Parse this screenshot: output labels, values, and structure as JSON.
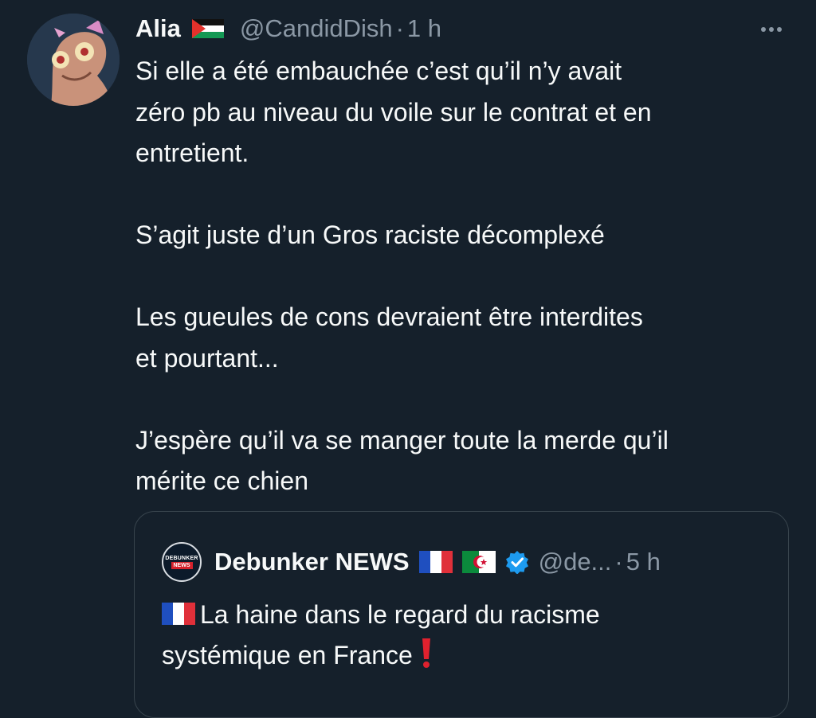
{
  "tweet": {
    "author_name": "Alia",
    "author_handle": "@CandidDish",
    "separator": "·",
    "time": "1 h",
    "author_flag_icon": "palestine-flag-icon",
    "text": "Si elle a été embauchée c’est qu’il n’y avait\nzéro pb au niveau du voile sur le contrat et en\nentretient.\n\nS’agit juste d’un Gros raciste décomplexé\n\nLes gueules de cons devraient être interdites\net pourtant...\n\nJ’espère qu’il va se manger toute la merde qu’il\nmérite ce chien",
    "more_icon": "more-options-icon"
  },
  "quote": {
    "avatar_text_top": "DEBUNKER",
    "avatar_text_bottom": "NEWS",
    "author_name": "Debunker NEWS",
    "author_handle": "@de...",
    "separator": "·",
    "time": "5 h",
    "flags": [
      "france-flag-icon",
      "algeria-flag-icon"
    ],
    "verified_icon": "verified-badge-icon",
    "text_line1": "La haine dans le regard du racisme",
    "text_line2": "systémique en France",
    "text_prefix_icon": "france-flag-icon",
    "text_suffix_icon": "red-exclamation-icon"
  },
  "colors": {
    "background": "#15202b",
    "text_primary": "#f7f9f9",
    "text_secondary": "#8b98a5",
    "border": "#38444d",
    "verified_blue": "#1d9bf0"
  }
}
